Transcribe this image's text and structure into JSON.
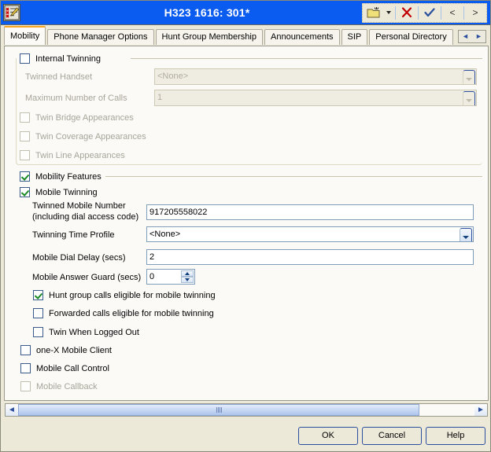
{
  "window": {
    "title": "H323 1616: 301*",
    "icon": "form-checklist-edit-icon"
  },
  "titlebar_tools": [
    {
      "name": "new-entry-button",
      "icon": "yellow-folder-new-icon",
      "label": ""
    },
    {
      "name": "new-entry-dropdown",
      "icon": "caret-down-icon",
      "label": ""
    },
    {
      "name": "delete-button",
      "icon": "red-x-icon",
      "label": "✘"
    },
    {
      "name": "validate-button",
      "icon": "blue-check-icon",
      "label": "✔"
    },
    {
      "name": "previous-button",
      "icon": "less-than-icon",
      "label": "<"
    },
    {
      "name": "next-button",
      "icon": "greater-than-icon",
      "label": ">"
    }
  ],
  "tabs": [
    {
      "label": "Mobility",
      "active": true
    },
    {
      "label": "Phone Manager Options",
      "active": false
    },
    {
      "label": "Hunt Group Membership",
      "active": false
    },
    {
      "label": "Announcements",
      "active": false
    },
    {
      "label": "SIP",
      "active": false
    },
    {
      "label": "Personal Directory",
      "active": false
    }
  ],
  "tab_nav": {
    "prev": "◄",
    "next": "►"
  },
  "internal_twinning": {
    "group_label": "Internal Twinning",
    "group_checked": false,
    "group_enabled": true,
    "twinned_handset": {
      "label": "Twinned Handset",
      "value": "<None>",
      "enabled": false
    },
    "maximum_number_of_calls": {
      "label": "Maximum Number of Calls",
      "value": "1",
      "enabled": false
    },
    "checkboxes": [
      {
        "label": "Twin Bridge Appearances",
        "checked": false,
        "enabled": false
      },
      {
        "label": "Twin Coverage Appearances",
        "checked": false,
        "enabled": false
      },
      {
        "label": "Twin Line Appearances",
        "checked": false,
        "enabled": false
      }
    ]
  },
  "mobility_features": {
    "group_label": "Mobility Features",
    "group_checked": true,
    "mobile_twinning": {
      "label": "Mobile Twinning",
      "checked": true
    },
    "twinned_mobile_number": {
      "label_line1": "Twinned Mobile Number",
      "label_line2": "(including dial access code)",
      "value": "917205558022"
    },
    "twinning_time_profile": {
      "label": "Twinning Time Profile",
      "value": "<None>"
    },
    "mobile_dial_delay": {
      "label": "Mobile Dial Delay (secs)",
      "value": "2"
    },
    "mobile_answer_guard": {
      "label": "Mobile Answer Guard (secs)",
      "value": "0"
    },
    "checkboxes": [
      {
        "label": "Hunt group calls eligible for mobile twinning",
        "checked": true,
        "enabled": true
      },
      {
        "label": "Forwarded calls eligible for mobile twinning",
        "checked": false,
        "enabled": true
      },
      {
        "label": "Twin When Logged Out",
        "checked": false,
        "enabled": true
      }
    ]
  },
  "bottom_options": [
    {
      "label": "one-X Mobile Client",
      "checked": false,
      "enabled": true
    },
    {
      "label": "Mobile Call Control",
      "checked": false,
      "enabled": true
    },
    {
      "label": "Mobile Callback",
      "checked": false,
      "enabled": false
    }
  ],
  "scrollbar": {
    "left_arrow": "◄",
    "right_arrow": "►"
  },
  "footer": {
    "ok": "OK",
    "cancel": "Cancel",
    "help": "Help"
  },
  "colors": {
    "titlebar": "#0a5bef",
    "active_tab_accent": "#f5a623",
    "check_green": "#1a8a24",
    "delete_red": "#c00000",
    "face": "#ece9d8"
  }
}
